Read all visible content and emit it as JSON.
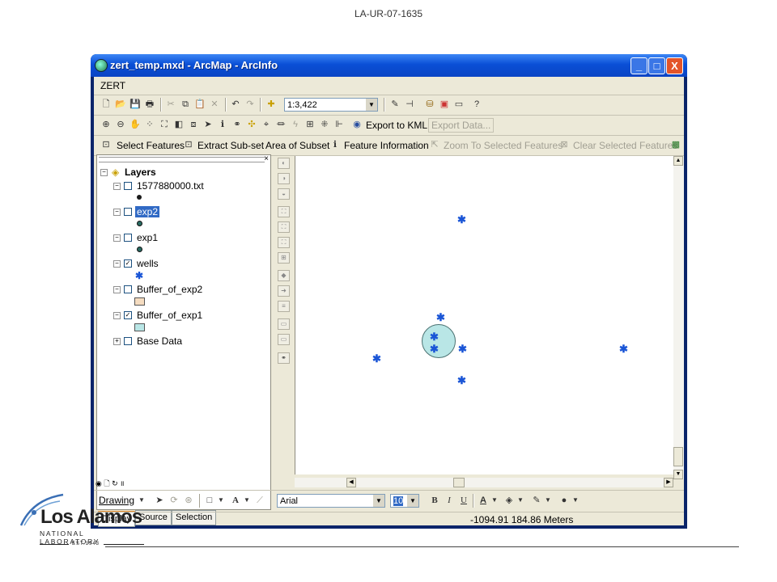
{
  "document_id": "LA-UR-07-1635",
  "window": {
    "title": "zert_temp.mxd - ArcMap - ArcInfo",
    "buttons": {
      "minimize": "_",
      "maximize": "□",
      "close": "X"
    }
  },
  "menubar": {
    "items": [
      "ZERT"
    ]
  },
  "standard_toolbar": {
    "scale_value": "1:3,422"
  },
  "tools_toolbar": {
    "export_kml_label": "Export to KML",
    "export_data_label": "Export Data..."
  },
  "zert_toolbar": {
    "items": [
      {
        "label": "Select Features",
        "enabled": true
      },
      {
        "label": "Extract Sub-set",
        "enabled": true
      },
      {
        "label": "Area of Subset",
        "enabled": true
      },
      {
        "label": "Feature Information",
        "enabled": true
      },
      {
        "label": "Zoom To Selected Features",
        "enabled": false
      },
      {
        "label": "Clear Selected Features",
        "enabled": false
      }
    ]
  },
  "toc": {
    "root": "Layers",
    "layers": [
      {
        "name": "1577880000.txt",
        "checked": false,
        "symbol": "dot"
      },
      {
        "name": "exp2",
        "checked": false,
        "symbol": "dot-teal",
        "selected": true
      },
      {
        "name": "exp1",
        "checked": false,
        "symbol": "dot-teal"
      },
      {
        "name": "wells",
        "checked": true,
        "symbol": "star"
      },
      {
        "name": "Buffer_of_exp2",
        "checked": false,
        "symbol": "box",
        "color": "#f5dcc0"
      },
      {
        "name": "Buffer_of_exp1",
        "checked": true,
        "symbol": "box",
        "color": "#b9e6e6"
      },
      {
        "name": "Base Data",
        "checked": false,
        "symbol": "none"
      }
    ],
    "tabs": [
      "Display",
      "Source",
      "Selection"
    ],
    "active_tab": "Display"
  },
  "drawing_toolbar": {
    "drawing_label": "Drawing",
    "font_name": "Arial",
    "font_size": "10"
  },
  "status": {
    "coordinates": "-1094.91  184.86 Meters"
  },
  "colors": {
    "accent_blue": "#1a55d6",
    "buffer_fill": "#b9e6e6",
    "selection": "#316ac5"
  },
  "logo": {
    "main_text": "Los Alamos",
    "subtitle": "NATIONAL LABORATORY",
    "est": "EST.1943"
  }
}
